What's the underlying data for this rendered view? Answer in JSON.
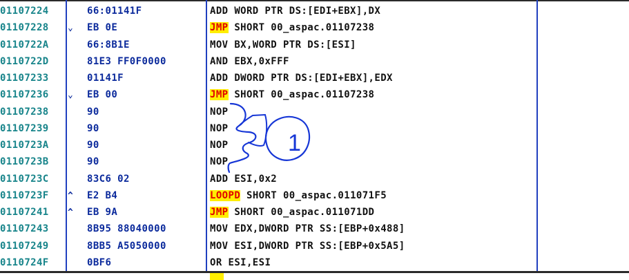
{
  "colors": {
    "address": "#17848a",
    "hex": "#0b2a9c",
    "text": "#111111",
    "jump_highlight_bg": "#ffee00",
    "jump_highlight_fg": "#e10000",
    "annotation": "#1636d6"
  },
  "annotation": {
    "label": "1"
  },
  "rows": [
    {
      "address": "01107224",
      "marker": "",
      "hex": "66:01141F",
      "mnemonic": "",
      "operands": "ADD WORD PTR DS:[EDI+EBX],DX"
    },
    {
      "address": "01107228",
      "marker": "⌄",
      "hex": "EB 0E",
      "mnemonic": "JMP",
      "operands": " SHORT 00_aspac.01107238"
    },
    {
      "address": "0110722A",
      "marker": "",
      "hex": "66:8B1E",
      "mnemonic": "",
      "operands": "MOV BX,WORD PTR DS:[ESI]"
    },
    {
      "address": "0110722D",
      "marker": "",
      "hex": "81E3 FF0F0000",
      "mnemonic": "",
      "operands": "AND EBX,0xFFF"
    },
    {
      "address": "01107233",
      "marker": "",
      "hex": "01141F",
      "mnemonic": "",
      "operands": "ADD DWORD PTR DS:[EDI+EBX],EDX"
    },
    {
      "address": "01107236",
      "marker": "⌄",
      "hex": "EB 00",
      "mnemonic": "JMP",
      "operands": " SHORT 00_aspac.01107238"
    },
    {
      "address": "01107238",
      "marker": "",
      "hex": "90",
      "mnemonic": "",
      "operands": "NOP"
    },
    {
      "address": "01107239",
      "marker": "",
      "hex": "90",
      "mnemonic": "",
      "operands": "NOP"
    },
    {
      "address": "0110723A",
      "marker": "",
      "hex": "90",
      "mnemonic": "",
      "operands": "NOP"
    },
    {
      "address": "0110723B",
      "marker": "",
      "hex": "90",
      "mnemonic": "",
      "operands": "NOP"
    },
    {
      "address": "0110723C",
      "marker": "",
      "hex": "83C6 02",
      "mnemonic": "",
      "operands": "ADD ESI,0x2"
    },
    {
      "address": "0110723F",
      "marker": "^",
      "hex": "E2 B4",
      "mnemonic": "LOOPD",
      "operands": " SHORT 00_aspac.011071F5"
    },
    {
      "address": "01107241",
      "marker": "^",
      "hex": "EB 9A",
      "mnemonic": "JMP",
      "operands": " SHORT 00_aspac.011071DD"
    },
    {
      "address": "01107243",
      "marker": "",
      "hex": "8B95 88040000",
      "mnemonic": "",
      "operands": "MOV EDX,DWORD PTR SS:[EBP+0x488]"
    },
    {
      "address": "01107249",
      "marker": "",
      "hex": "8BB5 A5050000",
      "mnemonic": "",
      "operands": "MOV ESI,DWORD PTR SS:[EBP+0x5A5]"
    },
    {
      "address": "0110724F",
      "marker": "",
      "hex": "0BF6",
      "mnemonic": "",
      "operands": "OR ESI,ESI"
    }
  ]
}
